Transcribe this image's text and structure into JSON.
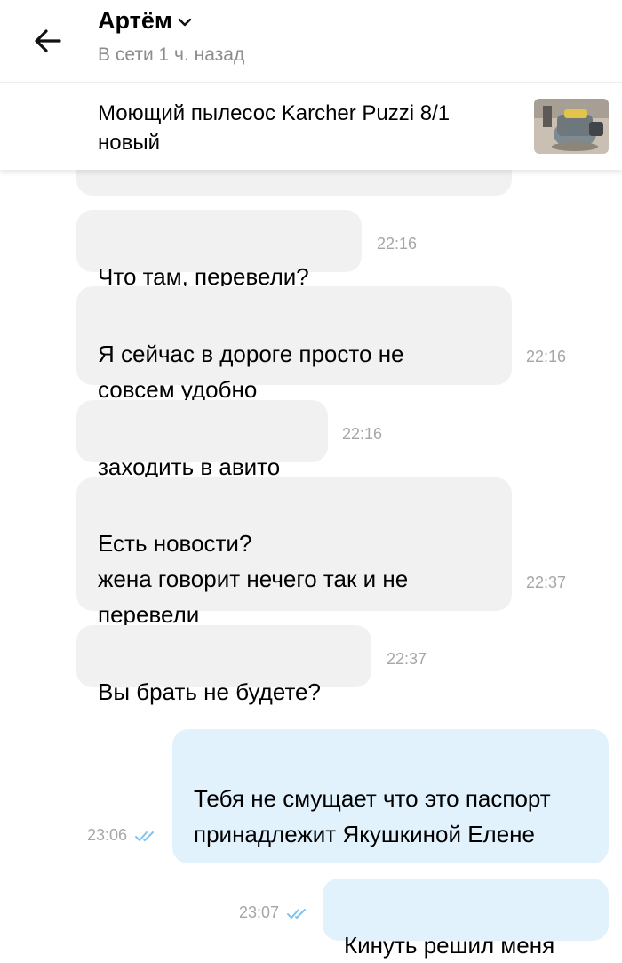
{
  "header": {
    "contact_name": "Артём",
    "status": "В сети 1 ч. назад"
  },
  "item": {
    "title": "Моющий пылесос Karcher Puzzi 8/1 новый"
  },
  "messages": [
    {
      "text": "Что там, перевели?",
      "time": "22:16"
    },
    {
      "text": "Я сейчас в дороге просто не совсем удобно",
      "time": "22:16"
    },
    {
      "text": "заходить в авито",
      "time": "22:16"
    },
    {
      "text": "Есть новости?\n жена говорит нечего так и не перевели",
      "time": "22:37"
    },
    {
      "text": "Вы брать не будете?",
      "time": "22:37"
    },
    {
      "text": "Тебя не смущает что это паспорт принадлежит Якушкиной Елене",
      "time": "23:06"
    },
    {
      "text": "Кинуть решил меня",
      "time": "23:07"
    }
  ],
  "colors": {
    "incoming_bubble": "#f1f1f1",
    "outgoing_bubble": "#e1f2fd",
    "read_ticks": "#7fc3f0",
    "time_text": "#a6a6a6"
  },
  "icons": [
    "back-arrow-icon",
    "chevron-down-icon",
    "read-ticks-icon"
  ]
}
